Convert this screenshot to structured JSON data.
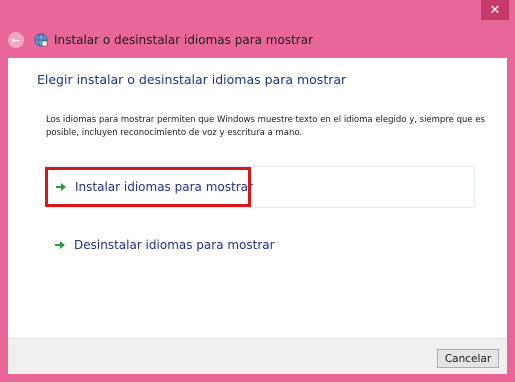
{
  "window": {
    "title": "Instalar o desinstalar idiomas para mostrar",
    "close_glyph": "✕",
    "back_glyph": "←"
  },
  "main": {
    "heading": "Elegir instalar o desinstalar idiomas para mostrar",
    "description": "Los idiomas para mostrar permiten que Windows muestre texto en el idioma elegido y, siempre que es posible, incluyen reconocimiento de voz y escritura a mano.",
    "options": [
      {
        "label": "Instalar idiomas para mostrar",
        "icon": "green-arrow-icon"
      },
      {
        "label": "Desinstalar idiomas para mostrar",
        "icon": "green-arrow-icon"
      }
    ]
  },
  "footer": {
    "cancel_label": "Cancelar"
  },
  "colors": {
    "frame": "#e8669a",
    "link": "#1e3287",
    "highlight": "#d9141c",
    "arrow": "#2e9a3e"
  }
}
